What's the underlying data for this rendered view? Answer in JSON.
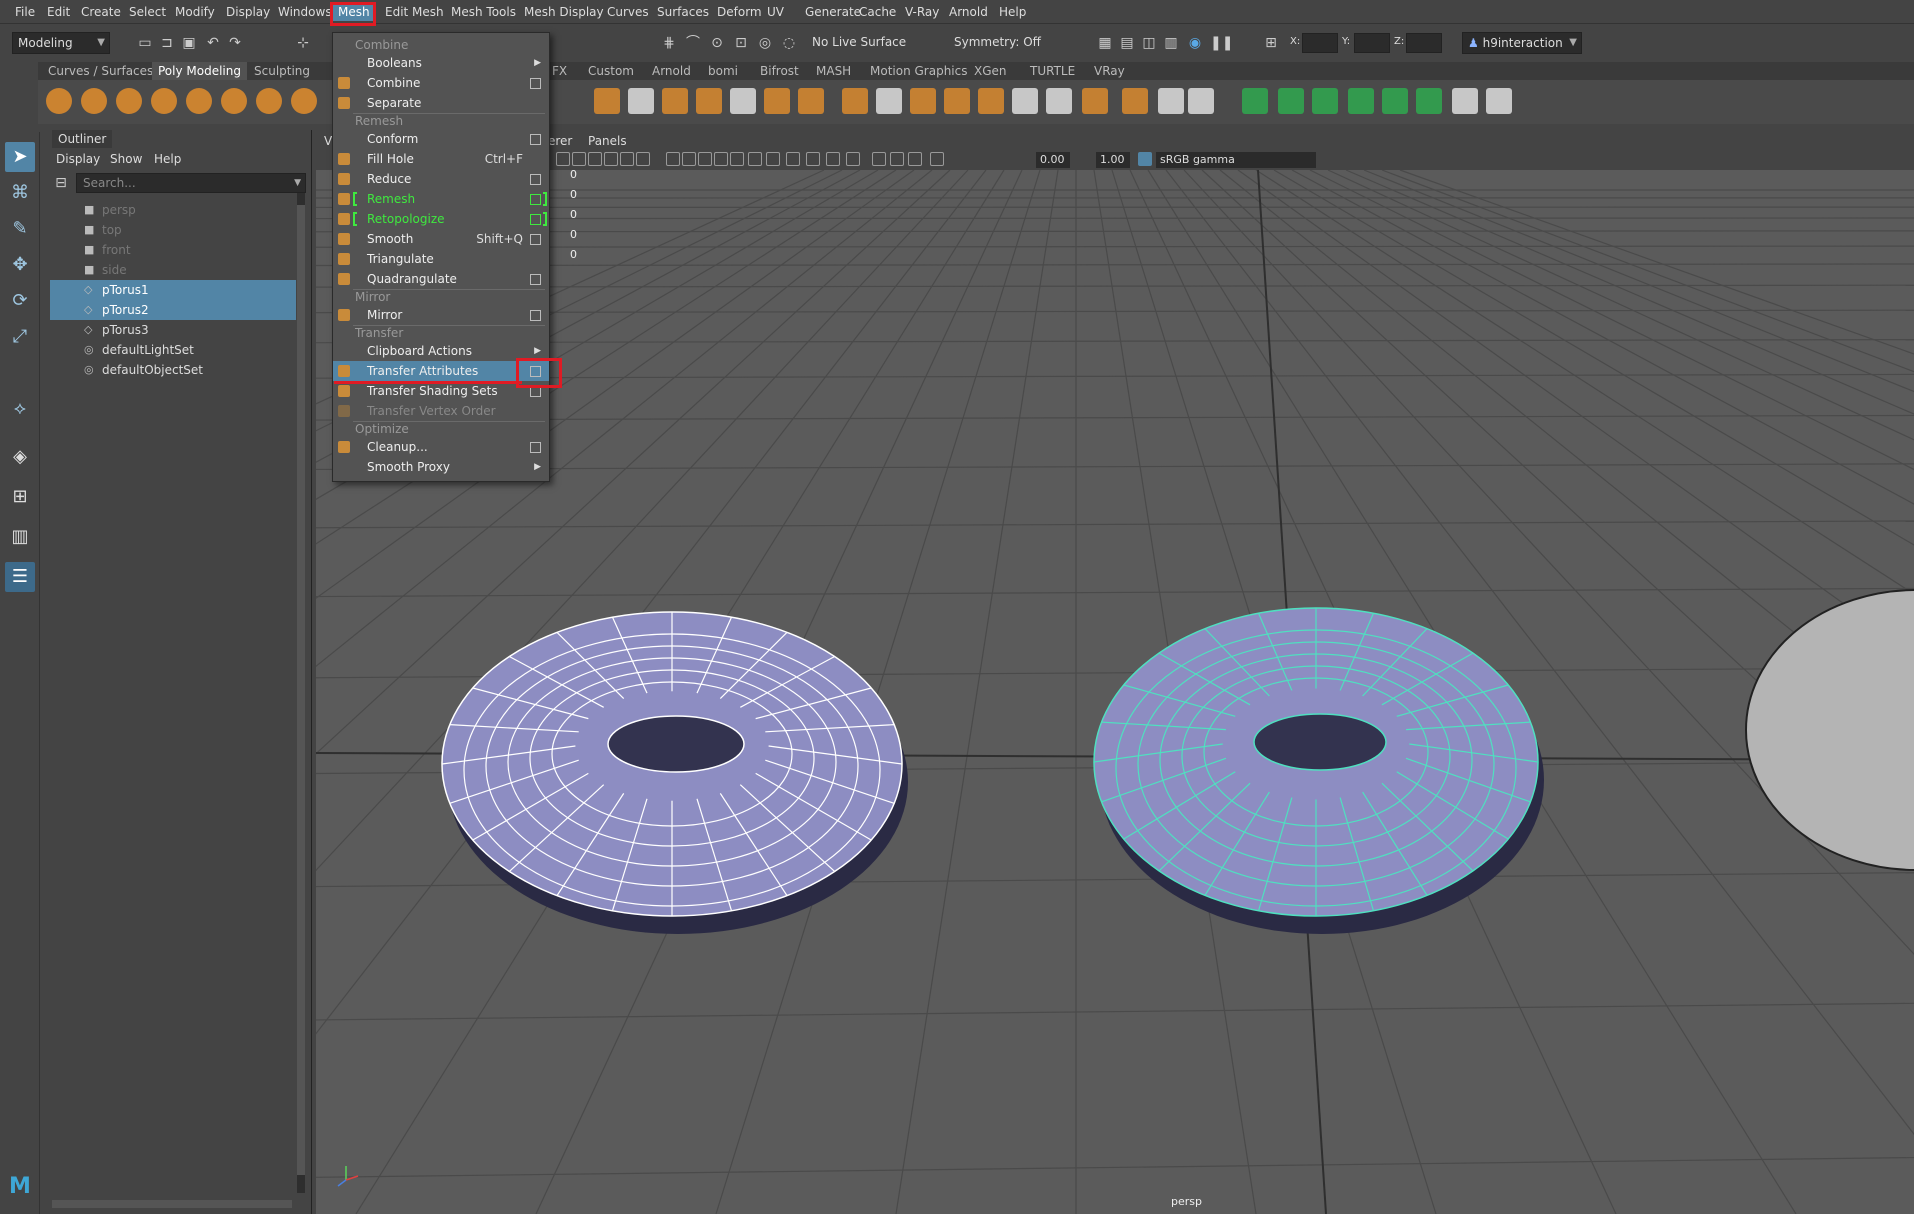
{
  "menubar": {
    "items": [
      "File",
      "Edit",
      "Create",
      "Select",
      "Modify",
      "Display",
      "Windows",
      "Mesh",
      "Edit Mesh",
      "Mesh Tools",
      "Mesh Display",
      "Curves",
      "Surfaces",
      "Deform",
      "UV",
      "Generate",
      "Cache",
      "V-Ray",
      "Arnold",
      "Help"
    ],
    "active": "Mesh"
  },
  "statusline": {
    "mode": "Modeling",
    "live_surface": "No Live Surface",
    "symmetry": "Symmetry: Off",
    "x_label": "X:",
    "y_label": "Y:",
    "z_label": "Z:",
    "user": "h9interaction"
  },
  "shelf": {
    "tabs": [
      "Curves / Surfaces",
      "Poly Modeling",
      "Sculpting",
      "FX",
      "Custom",
      "Arnold",
      "bomi",
      "Bifrost",
      "MASH",
      "Motion Graphics",
      "XGen",
      "TURTLE",
      "VRay"
    ],
    "active_tab": "Poly Modeling"
  },
  "outliner": {
    "title": "Outliner",
    "menu": [
      "Display",
      "Show",
      "Help"
    ],
    "search_placeholder": "Search...",
    "items": [
      {
        "label": "persp",
        "type": "camera",
        "dim": true,
        "selected": false
      },
      {
        "label": "top",
        "type": "camera",
        "dim": true,
        "selected": false
      },
      {
        "label": "front",
        "type": "camera",
        "dim": true,
        "selected": false
      },
      {
        "label": "side",
        "type": "camera",
        "dim": true,
        "selected": false
      },
      {
        "label": "pTorus1",
        "type": "mesh",
        "dim": false,
        "selected": true
      },
      {
        "label": "pTorus2",
        "type": "mesh",
        "dim": false,
        "selected": true
      },
      {
        "label": "pTorus3",
        "type": "mesh",
        "dim": false,
        "selected": false
      },
      {
        "label": "defaultLightSet",
        "type": "set",
        "dim": false,
        "selected": false
      },
      {
        "label": "defaultObjectSet",
        "type": "set",
        "dim": false,
        "selected": false
      }
    ]
  },
  "viewport": {
    "menu": [
      "V",
      "erer",
      "Panels"
    ],
    "exposure": "0.00",
    "gamma": "1.00",
    "color_space": "sRGB gamma",
    "hud_values": [
      "0",
      "0",
      "0",
      "0",
      "0"
    ],
    "camera": "persp"
  },
  "mesh_menu": {
    "items": [
      {
        "kind": "section",
        "label": "Combine"
      },
      {
        "kind": "item",
        "label": "Booleans",
        "submenu": true
      },
      {
        "kind": "item",
        "label": "Combine",
        "option": true,
        "icon": true
      },
      {
        "kind": "item",
        "label": "Separate",
        "icon": true
      },
      {
        "kind": "section",
        "label": "Remesh"
      },
      {
        "kind": "item",
        "label": "Conform",
        "option": true
      },
      {
        "kind": "item",
        "label": "Fill Hole",
        "shortcut": "Ctrl+F",
        "icon": true
      },
      {
        "kind": "item",
        "label": "Reduce",
        "option": true,
        "icon": true
      },
      {
        "kind": "item",
        "label": "Remesh",
        "option": true,
        "green": true,
        "icon": true
      },
      {
        "kind": "item",
        "label": "Retopologize",
        "option": true,
        "green": true,
        "icon": true
      },
      {
        "kind": "item",
        "label": "Smooth",
        "shortcut": "Shift+Q",
        "option": true,
        "icon": true
      },
      {
        "kind": "item",
        "label": "Triangulate",
        "icon": true
      },
      {
        "kind": "item",
        "label": "Quadrangulate",
        "option": true,
        "icon": true
      },
      {
        "kind": "section",
        "label": "Mirror"
      },
      {
        "kind": "item",
        "label": "Mirror",
        "option": true,
        "icon": true
      },
      {
        "kind": "section",
        "label": "Transfer"
      },
      {
        "kind": "item",
        "label": "Clipboard Actions",
        "submenu": true
      },
      {
        "kind": "item",
        "label": "Transfer Attributes",
        "option": true,
        "active": true,
        "icon": true
      },
      {
        "kind": "item",
        "label": "Transfer Shading Sets",
        "option": true,
        "icon": true
      },
      {
        "kind": "item",
        "label": "Transfer Vertex Order",
        "disabled": true,
        "icon": true
      },
      {
        "kind": "section",
        "label": "Optimize"
      },
      {
        "kind": "item",
        "label": "Cleanup...",
        "option": true,
        "icon": true
      },
      {
        "kind": "item",
        "label": "Smooth Proxy",
        "submenu": true
      }
    ]
  },
  "colors": {
    "highlight": "#5285a6",
    "annotation_red": "#e01b24",
    "green_text": "#3fe93f",
    "wire_selected": "#4fe0c0",
    "torus_fill": "#8a8ac0"
  }
}
